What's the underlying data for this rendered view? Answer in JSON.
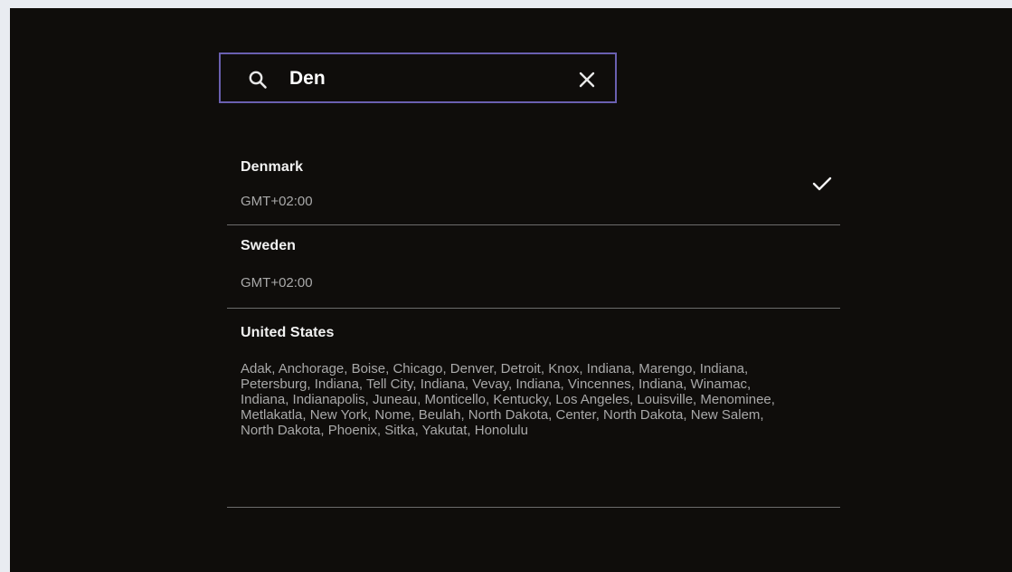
{
  "search": {
    "value": "Den",
    "icon": "search-icon",
    "clear_icon": "close-icon",
    "accent_color": "#6a60b0"
  },
  "results": [
    {
      "country": "Denmark",
      "zones": "GMT+02:00",
      "selected": true
    },
    {
      "country": "Sweden",
      "zones": "GMT+02:00",
      "selected": false
    },
    {
      "country": "United States",
      "zones": "Adak, Anchorage, Boise, Chicago, Denver, Detroit, Knox, Indiana, Marengo, Indiana, Petersburg, Indiana, Tell City, Indiana, Vevay, Indiana, Vincennes, Indiana, Winamac, Indiana, Indianapolis, Juneau, Monticello, Kentucky, Los Angeles, Louisville, Menominee, Metlakatla, New York, Nome, Beulah, North Dakota, Center, North Dakota, New Salem, North Dakota, Phoenix, Sitka, Yakutat, Honolulu",
      "selected": false
    }
  ]
}
